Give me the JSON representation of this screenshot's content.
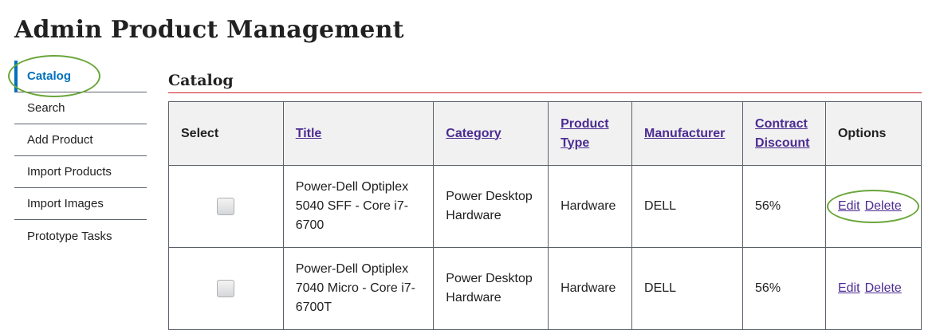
{
  "page": {
    "title": "Admin Product Management"
  },
  "sidebar": {
    "items": [
      {
        "label": "Catalog",
        "active": true
      },
      {
        "label": "Search"
      },
      {
        "label": "Add Product"
      },
      {
        "label": "Import Products"
      },
      {
        "label": "Import Images"
      },
      {
        "label": "Prototype Tasks"
      }
    ]
  },
  "main": {
    "section_title": "Catalog",
    "table": {
      "headers": {
        "select": "Select",
        "title": "Title",
        "category": "Category",
        "product_type": "Product Type",
        "manufacturer": "Manufacturer",
        "contract_discount": "Contract Discount",
        "options": "Options"
      },
      "rows": [
        {
          "title": "Power-Dell Optiplex 5040 SFF - Core i7-6700",
          "category": "Power Desktop Hardware",
          "product_type": "Hardware",
          "manufacturer": "DELL",
          "contract_discount": "56%",
          "edit_label": "Edit",
          "delete_label": "Delete"
        },
        {
          "title": "Power-Dell Optiplex 7040 Micro - Core i7-6700T",
          "category": "Power Desktop Hardware",
          "product_type": "Hardware",
          "manufacturer": "DELL",
          "contract_discount": "56%",
          "edit_label": "Edit",
          "delete_label": "Delete"
        }
      ]
    }
  },
  "colors": {
    "accent_blue": "#0071bc",
    "visited_link": "#4c2c92",
    "section_rule": "#cd2026",
    "highlight_circle": "#6aa63a"
  }
}
